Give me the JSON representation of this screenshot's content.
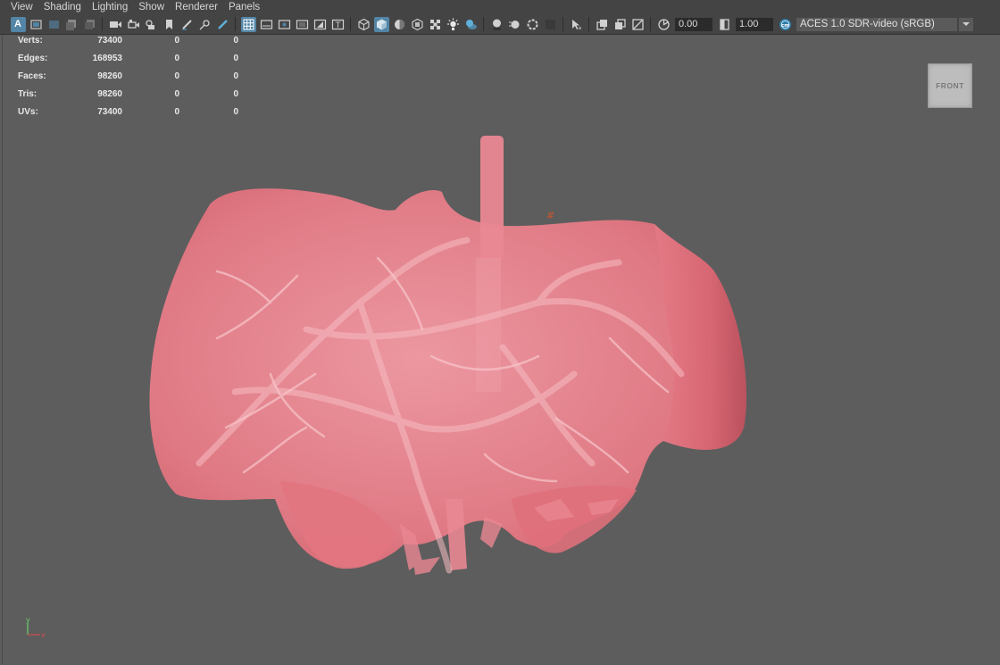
{
  "menu": [
    "View",
    "Shading",
    "Lighting",
    "Show",
    "Renderer",
    "Panels"
  ],
  "toolbar": {
    "icons": [
      "select-camera-icon",
      "camera-attributes-icon",
      "bookmarks-icon",
      "image-plane-icon",
      "film-gate-icon",
      "resolution-gate-icon",
      "gate-mask-icon",
      "field-chart-icon",
      "safe-action-icon",
      "safe-title-icon",
      "wireframe-icon",
      "smooth-shade-icon",
      "default-material-icon",
      "textured-icon",
      "use-all-lights-icon",
      "shadows-icon",
      "ambient-occlusion-icon",
      "motion-blur-icon",
      "anti-aliasing-icon",
      "isolate-select-icon",
      "xray-icon",
      "xray-active-components-icon",
      "xray-joints-icon"
    ],
    "exposure": "0.00",
    "gamma": "1.00",
    "color_space": "ACES 1.0 SDR-video (sRGB)"
  },
  "hud": [
    {
      "label": "Verts:",
      "v1": "73400",
      "v2": "0",
      "v3": "0"
    },
    {
      "label": "Edges:",
      "v1": "168953",
      "v2": "0",
      "v3": "0"
    },
    {
      "label": "Faces:",
      "v1": "98260",
      "v2": "0",
      "v3": "0"
    },
    {
      "label": "Tris:",
      "v1": "98260",
      "v2": "0",
      "v3": "0"
    },
    {
      "label": "UVs:",
      "v1": "73400",
      "v2": "0",
      "v3": "0"
    }
  ],
  "viewcube": {
    "face": "FRONT"
  },
  "axis": {
    "y": "y",
    "x": "x"
  },
  "colors": {
    "mesh": "#e57b86",
    "background": "#5d5d5d",
    "highlight": "#5285a6"
  }
}
